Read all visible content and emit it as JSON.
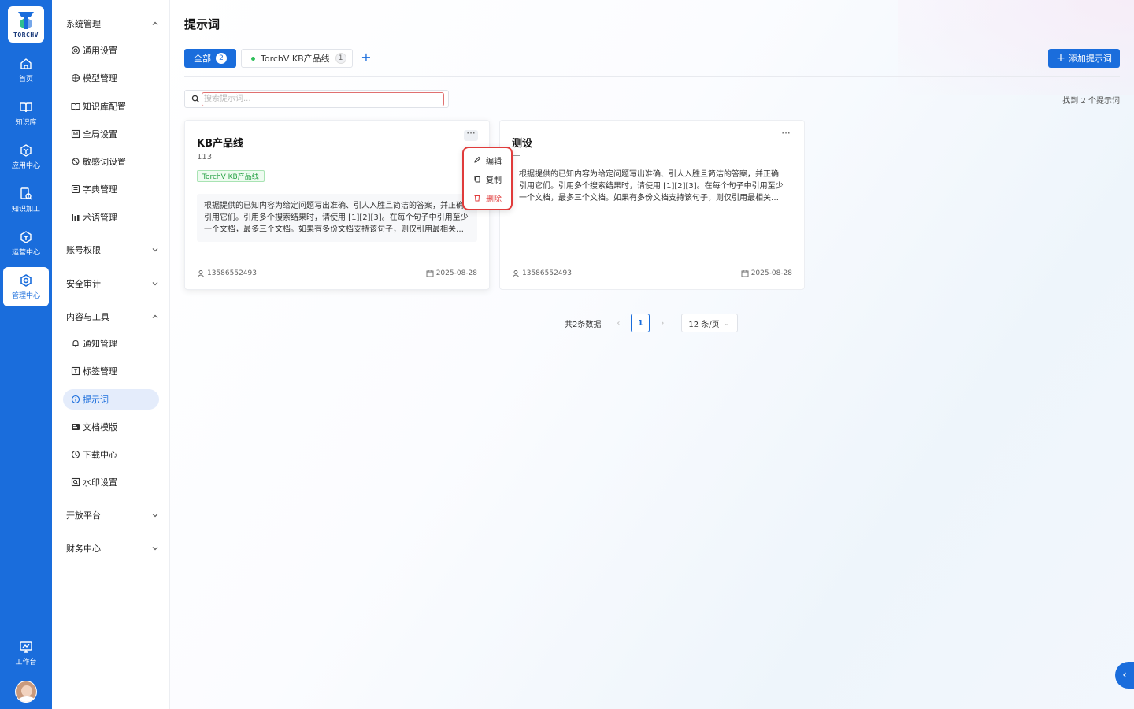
{
  "rail": {
    "logo_text": "TORCHV",
    "items": [
      {
        "label": "首页",
        "icon": "home-icon"
      },
      {
        "label": "知识库",
        "icon": "book-icon"
      },
      {
        "label": "应用中心",
        "icon": "app-center-icon"
      },
      {
        "label": "知识加工",
        "icon": "knowledge-process-icon"
      },
      {
        "label": "运营中心",
        "icon": "operations-icon"
      },
      {
        "label": "管理中心",
        "icon": "admin-icon"
      }
    ],
    "workbench": "工作台"
  },
  "subnav": {
    "system_group": "系统管理",
    "system_items": [
      "通用设置",
      "模型管理",
      "知识库配置",
      "全局设置",
      "敏感词设置",
      "字典管理",
      "术语管理"
    ],
    "account_group": "账号权限",
    "audit_group": "安全审计",
    "content_group": "内容与工具",
    "content_items": [
      "通知管理",
      "标签管理",
      "提示词",
      "文档模版",
      "下载中心",
      "水印设置"
    ],
    "open_group": "开放平台",
    "finance_group": "财务中心"
  },
  "page": {
    "title": "提示词",
    "tab_all": "全部",
    "tab_all_count": "2",
    "tab_line": "TorchV KB产品线",
    "tab_line_count": "1",
    "add_button": "添加提示词",
    "search_placeholder": "搜索提示词...",
    "found_text": "找到 2 个提示词"
  },
  "cards": [
    {
      "title": "KB产品线",
      "subtitle": "113",
      "tag": "TorchV KB产品线",
      "content": "根据提供的已知内容为给定问题写出准确、引人入胜且简洁的答案，并正确引用它们。引用多个搜索结果时，请使用 [1][2][3]。在每个句子中引用至少一个文档，最多三个文档。如果有多份文档支持该句子，则仅引用最相关的文档。",
      "user": "13586552493",
      "date": "2025-08-28"
    },
    {
      "title": "测设",
      "content": "根据提供的已知内容为给定问题写出准确、引人入胜且简洁的答案，并正确引用它们。引用多个搜索结果时，请使用 [1][2][3]。在每个句子中引用至少一个文档，最多三个文档。如果有多份文档支持该句子，则仅引用最相关的文档。",
      "user": "13586552493",
      "date": "2025-08-28"
    }
  ],
  "menu": {
    "edit": "编辑",
    "copy": "复制",
    "delete": "删除"
  },
  "pager": {
    "total": "共2条数据",
    "current": "1",
    "page_size": "12 条/页"
  },
  "colors": {
    "primary": "#1a6ddc",
    "danger": "#e03b3b",
    "tag_green": "#27a245"
  }
}
